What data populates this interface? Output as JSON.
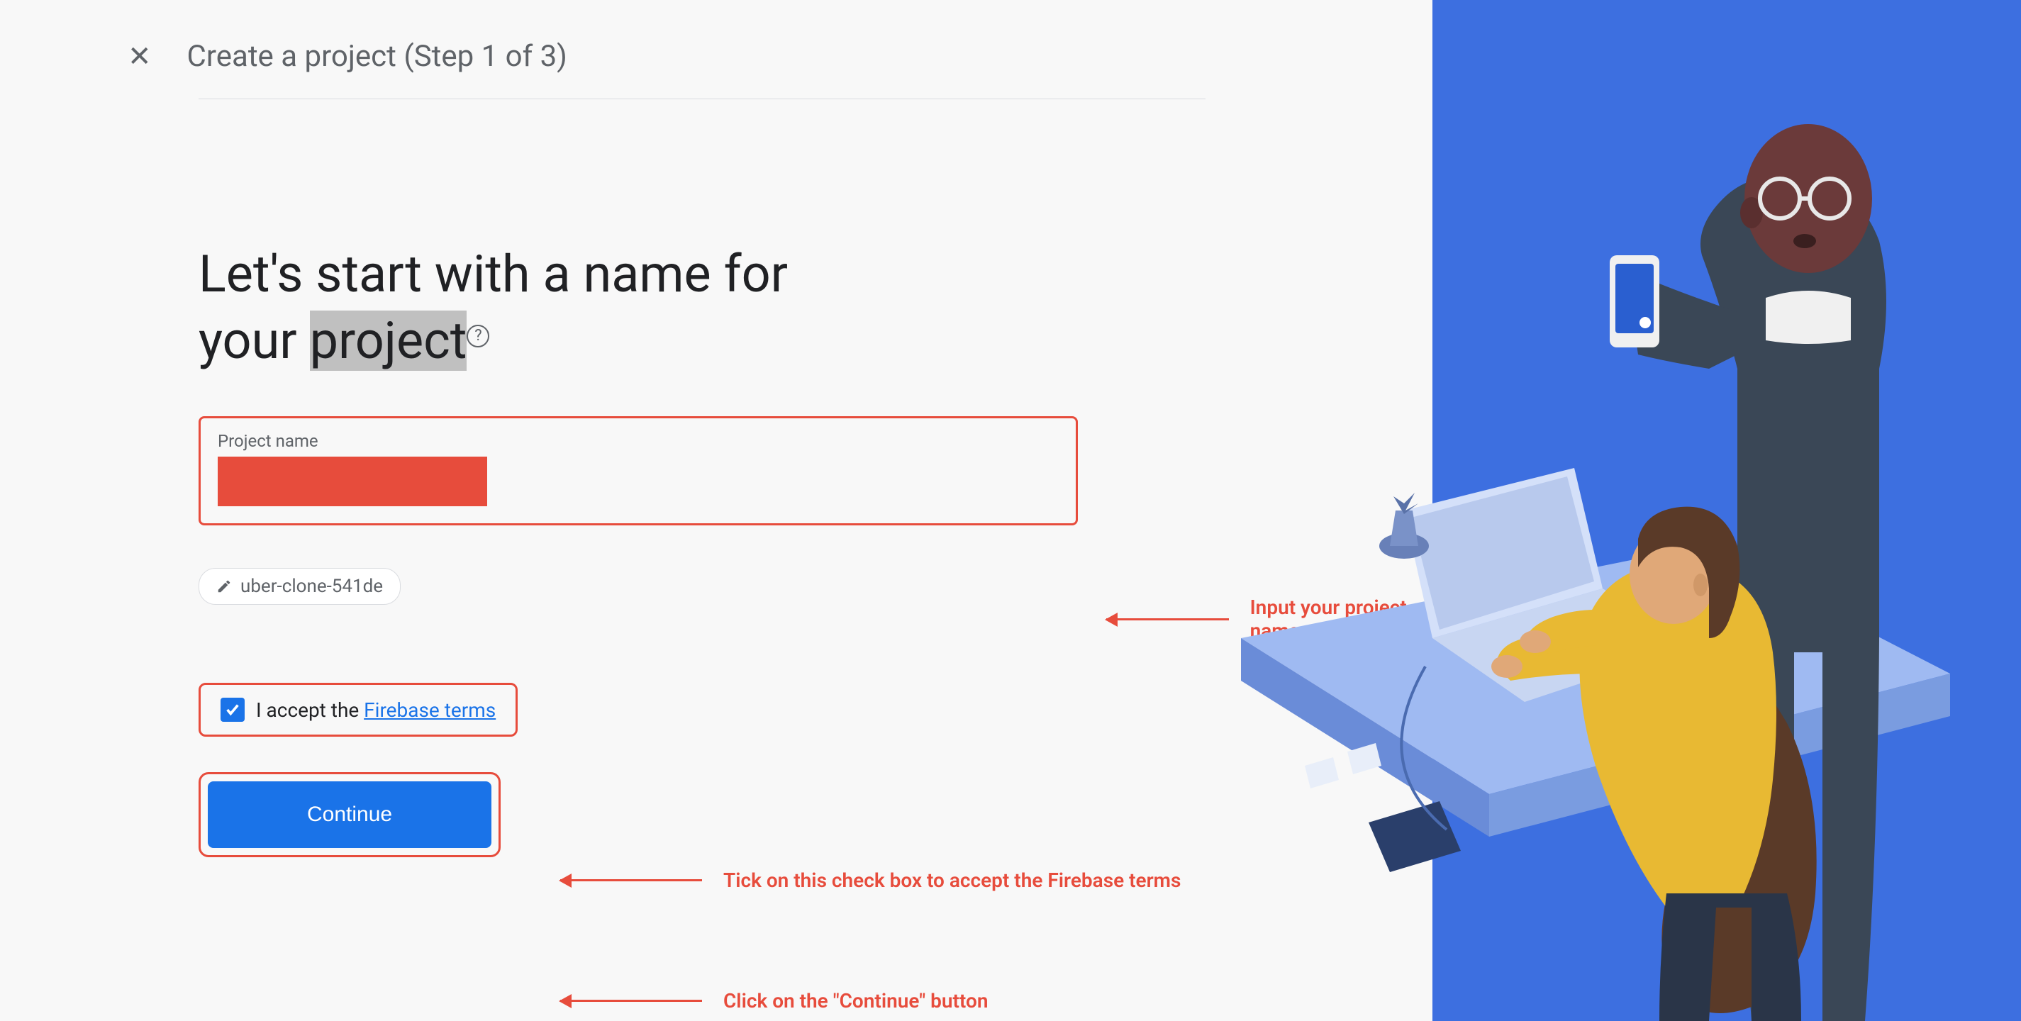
{
  "header": {
    "title": "Create a project (Step 1 of 3)"
  },
  "form": {
    "heading_part1": "Let's start with a name for",
    "heading_part2": "your ",
    "heading_highlighted": "project",
    "input_label": "Project name",
    "project_id": "uber-clone-541de",
    "terms_prefix": "I accept the ",
    "terms_link": "Firebase terms",
    "continue_label": "Continue"
  },
  "annotations": {
    "input": "Input your project name",
    "checkbox": "Tick on this check box to accept the Firebase terms",
    "continue": "Click on the \"Continue\" button"
  }
}
